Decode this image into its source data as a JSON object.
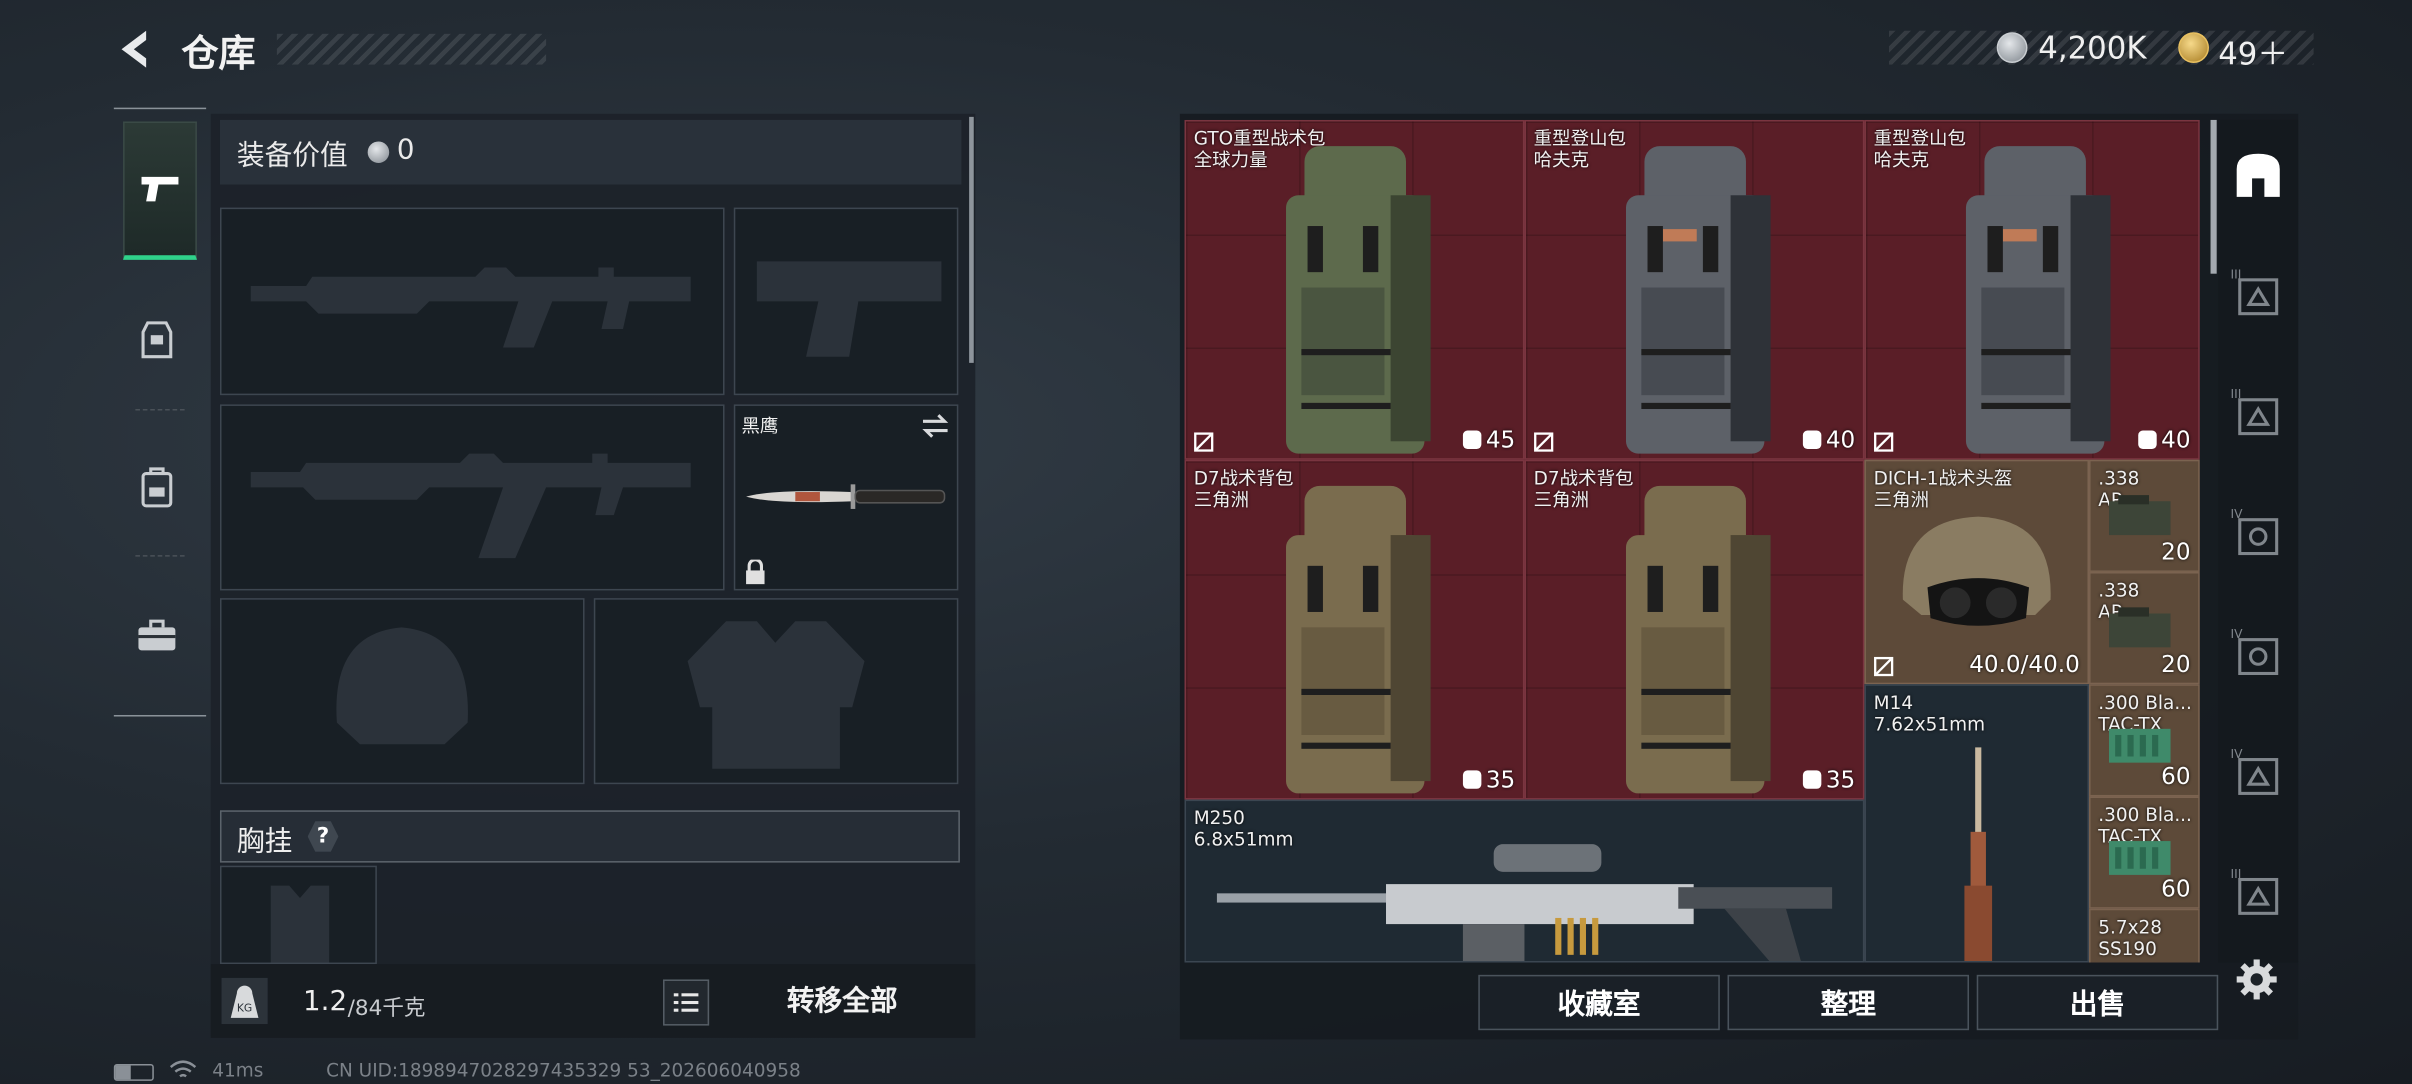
{
  "header": {
    "title": "仓库",
    "currency": "4,200K",
    "tokens": "49＋"
  },
  "loadout": {
    "value_label": "装备价值",
    "value": "0",
    "knife_name": "黑鹰",
    "rig_label": "胸挂",
    "rig_help": "?",
    "weight_current": "1.2",
    "weight_max": "/84千克",
    "weight_icon": "KG",
    "transfer_all": "转移全部"
  },
  "stash": {
    "items": [
      {
        "name": "GTO重型战术包",
        "sub": "全球力量",
        "count": "45",
        "color": "#5d6a4c"
      },
      {
        "name": "重型登山包",
        "sub": "哈夫克",
        "count": "40",
        "color": "#5d6168"
      },
      {
        "name": "重型登山包",
        "sub": "哈夫克",
        "count": "40",
        "color": "#5d6168"
      },
      {
        "name": "D7战术背包",
        "sub": "三角洲",
        "count": "35",
        "color": "#7a6c4e"
      },
      {
        "name": "D7战术背包",
        "sub": "三角洲",
        "count": "35",
        "color": "#7a6c4e"
      },
      {
        "name": "DICH-1战术头盔",
        "sub": "三角洲",
        "count": "40.0/40.0"
      },
      {
        "name": ".338",
        "sub": "AP",
        "count": "20"
      },
      {
        "name": ".338",
        "sub": "AP",
        "count": "20"
      },
      {
        "name": "M14",
        "sub": "7.62x51mm"
      },
      {
        "name": ".300 Bla...",
        "sub": "TAC-TX",
        "count": "60"
      },
      {
        "name": ".300 Bla...",
        "sub": "TAC-TX",
        "count": "60"
      },
      {
        "name": "M250",
        "sub": "6.8x51mm"
      },
      {
        "name": "5.7x28",
        "sub": "SS190"
      }
    ]
  },
  "actions": {
    "collection": "收藏室",
    "organize": "整理",
    "sell": "出售"
  },
  "filters": [
    "III",
    "III",
    "IV",
    "IV",
    "IV",
    "III"
  ],
  "status": {
    "ping": "41ms",
    "uid": "CN UID:1898947028297435329 53_202606040958"
  },
  "colors": {
    "accent": "#2fd28a",
    "stash_cell": "#5a1e27"
  }
}
